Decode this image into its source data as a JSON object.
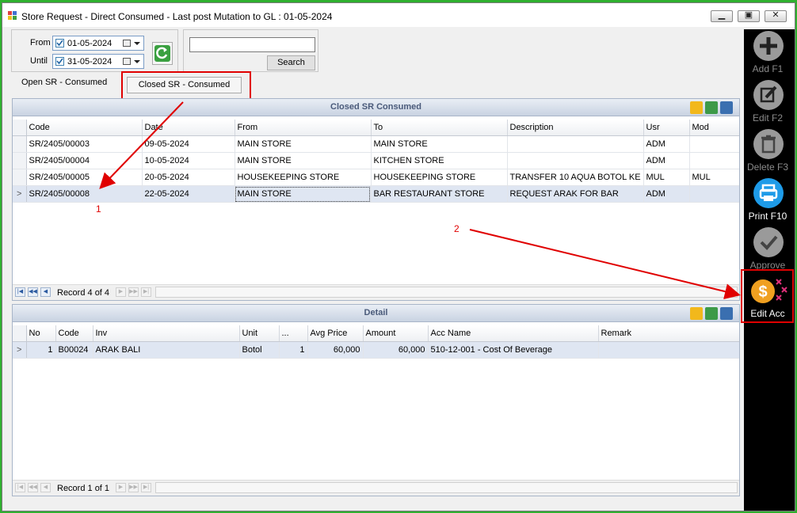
{
  "window": {
    "title": "Store Request - Direct Consumed - Last post Mutation to GL : 01-05-2024"
  },
  "filter": {
    "from_label": "From",
    "until_label": "Until",
    "from_value": "01-05-2024",
    "until_value": "31-05-2024",
    "search_value": "",
    "search_button": "Search"
  },
  "tabs": [
    {
      "label": "Open SR - Consumed",
      "active": false
    },
    {
      "label": "Closed SR - Consumed",
      "active": true
    }
  ],
  "master": {
    "title": "Closed SR Consumed",
    "columns": [
      "Code",
      "Date",
      "From",
      "To",
      "Description",
      "Usr",
      "Mod"
    ],
    "rows": [
      [
        "SR/2405/00003",
        "09-05-2024",
        "MAIN STORE",
        "MAIN STORE",
        "",
        "ADM",
        ""
      ],
      [
        "SR/2405/00004",
        "10-05-2024",
        "MAIN STORE",
        "KITCHEN STORE",
        "",
        "ADM",
        ""
      ],
      [
        "SR/2405/00005",
        "20-05-2024",
        "HOUSEKEEPING STORE",
        "HOUSEKEEPING STORE",
        "TRANSFER 10 AQUA BOTOL KE ...",
        "MUL",
        "MUL"
      ],
      [
        "SR/2405/00008",
        "22-05-2024",
        "MAIN STORE",
        "BAR RESTAURANT STORE",
        "REQUEST ARAK FOR BAR",
        "ADM",
        ""
      ]
    ],
    "selected_row": 3,
    "record_text": "Record 4 of 4"
  },
  "detail": {
    "title": "Detail",
    "columns": [
      "No",
      "Code",
      "Inv",
      "Unit",
      "...",
      "Avg Price",
      "Amount",
      "Acc Name",
      "Remark"
    ],
    "rows": [
      [
        "1",
        "B00024",
        "ARAK BALI",
        "Botol",
        "1",
        "60,000",
        "60,000",
        "510-12-001 - Cost Of Beverage",
        ""
      ]
    ],
    "record_text": "Record 1 of 1"
  },
  "sidebar": {
    "add": "Add F1",
    "edit": "Edit F2",
    "delete": "Delete F3",
    "print": "Print F10",
    "approve": "Approve",
    "edit_acc": "Edit Acc"
  },
  "annotations": {
    "one": "1",
    "two": "2"
  },
  "colors": {
    "accent_red": "#e00000",
    "print_blue": "#1e9be8",
    "coin_orange": "#f0a020"
  }
}
